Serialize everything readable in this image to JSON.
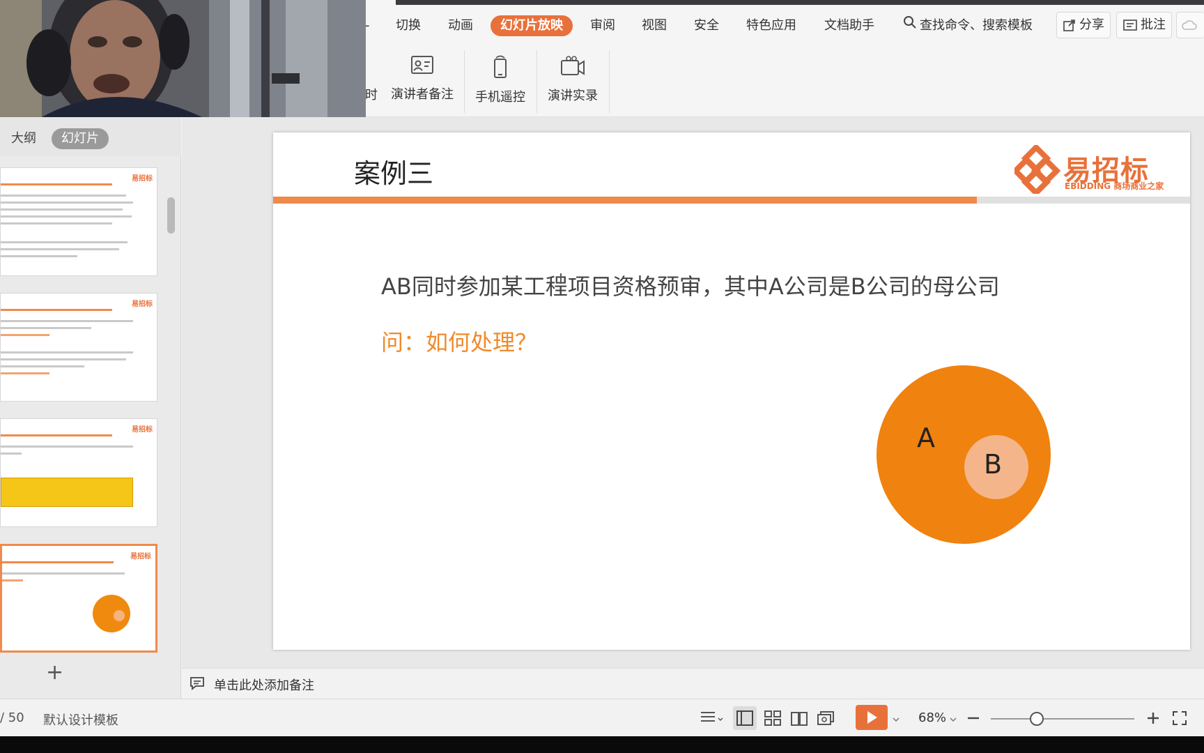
{
  "ribbon": {
    "tabs": [
      {
        "label": "切换"
      },
      {
        "label": "动画"
      },
      {
        "label": "幻灯片放映"
      },
      {
        "label": "审阅"
      },
      {
        "label": "视图"
      },
      {
        "label": "安全"
      },
      {
        "label": "特色应用"
      },
      {
        "label": "文档助手"
      }
    ],
    "tab_cut_glyph": "-",
    "active_tab": "幻灯片放映",
    "search_label": "查找命令、搜索模板",
    "share_label": "分享",
    "comment_label": "批注",
    "tools": [
      {
        "label": "演讲者备注",
        "icon": "speaker-notes-icon"
      },
      {
        "label": "手机遥控",
        "icon": "phone-remote-icon"
      },
      {
        "label": "演讲实录",
        "icon": "record-video-icon"
      }
    ],
    "partial_tool_label": "时",
    "accent_color": "#e8713b"
  },
  "left_panel": {
    "tab_outline": "大纲",
    "tab_slides": "幻灯片",
    "thumbnail_logo": "易招标",
    "add_slide_symbol": "+"
  },
  "slide": {
    "title": "案例三",
    "brand_name": "易招标",
    "brand_sub": "EBIDDING 商场商业之家",
    "line1": "AB同时参加某工程项目资格预审，其中A公司是B公司的母公司",
    "line2": "问：如何处理？",
    "circle_a_label": "A",
    "circle_b_label": "B",
    "orange": "#f0820f",
    "light_orange": "#f5b58a"
  },
  "notes": {
    "placeholder": "单击此处添加备注"
  },
  "status_bar": {
    "page_count": "/ 50",
    "template": "默认设计模板",
    "zoom": "68%",
    "zoom_fraction": 0.32
  }
}
